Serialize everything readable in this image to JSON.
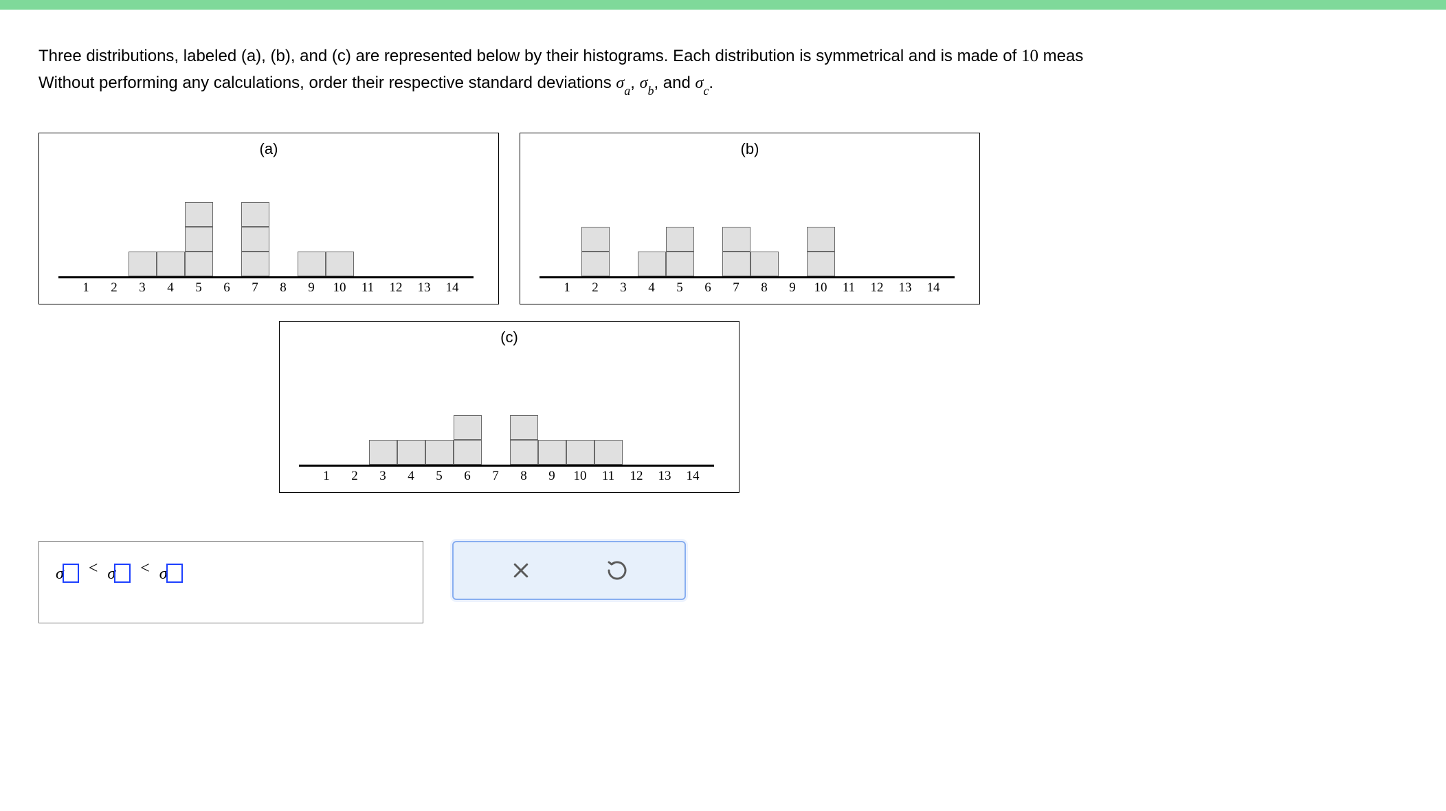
{
  "problem": {
    "line1_prefix": "Three distributions, labeled (a), (b), and (c) are represented below by their histograms. Each distribution is symmetrical and is made of ",
    "line1_num": "10",
    "line1_suffix": " meas",
    "line2_prefix": "Without performing any calculations, order their respective standard deviations ",
    "sig": "σ",
    "sub_a": "a",
    "comma": ", ",
    "sub_b": "b",
    "and": " and ",
    "sub_c": "c",
    "period": "."
  },
  "histograms": {
    "a": {
      "label": "(a)",
      "xticks": [
        "1",
        "2",
        "3",
        "4",
        "5",
        "6",
        "7",
        "8",
        "9",
        "10",
        "11",
        "12",
        "13",
        "14"
      ]
    },
    "b": {
      "label": "(b)",
      "xticks": [
        "1",
        "2",
        "3",
        "4",
        "5",
        "6",
        "7",
        "8",
        "9",
        "10",
        "11",
        "12",
        "13",
        "14"
      ]
    },
    "c": {
      "label": "(c)",
      "xticks": [
        "1",
        "2",
        "3",
        "4",
        "5",
        "6",
        "7",
        "8",
        "9",
        "10",
        "11",
        "12",
        "13",
        "14"
      ]
    }
  },
  "answer": {
    "sigma": "σ",
    "lt": "<"
  },
  "tools": {
    "clear": "clear",
    "reset": "reset"
  },
  "chart_data": [
    {
      "id": "a",
      "type": "bar",
      "title": "(a)",
      "categories": [
        1,
        2,
        3,
        4,
        5,
        6,
        7,
        8,
        9,
        10,
        11,
        12,
        13,
        14
      ],
      "values": [
        0,
        0,
        1,
        1,
        3,
        0,
        3,
        0,
        1,
        1,
        0,
        0,
        0,
        0
      ],
      "xlabel": "",
      "ylabel": "",
      "ylim": [
        0,
        3
      ]
    },
    {
      "id": "b",
      "type": "bar",
      "title": "(b)",
      "categories": [
        1,
        2,
        3,
        4,
        5,
        6,
        7,
        8,
        9,
        10,
        11,
        12,
        13,
        14
      ],
      "values": [
        0,
        2,
        0,
        1,
        2,
        0,
        2,
        1,
        0,
        2,
        0,
        0,
        0,
        0
      ],
      "xlabel": "",
      "ylabel": "",
      "ylim": [
        0,
        2
      ]
    },
    {
      "id": "c",
      "type": "bar",
      "title": "(c)",
      "categories": [
        1,
        2,
        3,
        4,
        5,
        6,
        7,
        8,
        9,
        10,
        11,
        12,
        13,
        14
      ],
      "values": [
        0,
        0,
        1,
        1,
        1,
        2,
        0,
        2,
        1,
        1,
        1,
        0,
        0,
        0
      ],
      "xlabel": "",
      "ylabel": "",
      "ylim": [
        0,
        2
      ]
    }
  ]
}
